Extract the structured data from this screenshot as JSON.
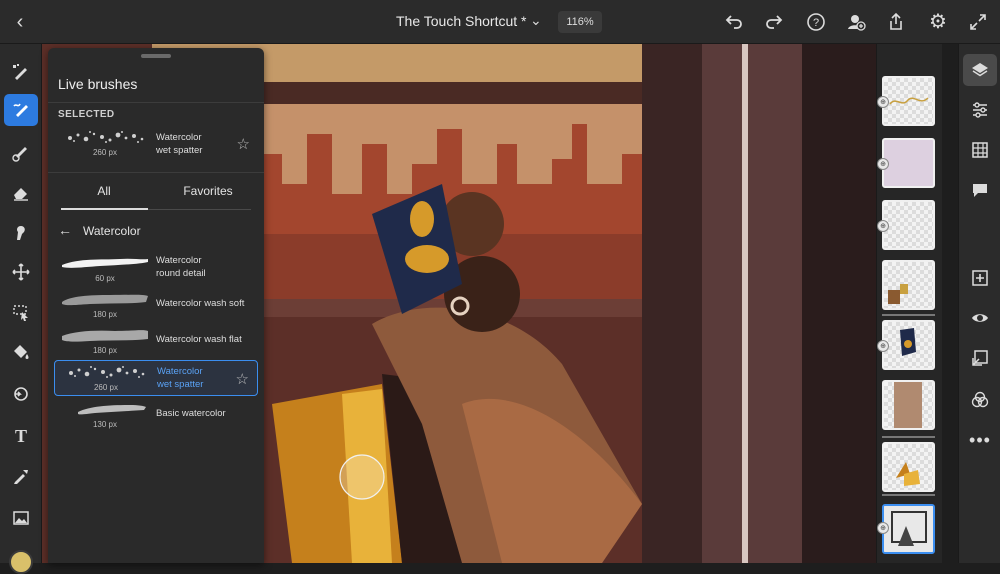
{
  "header": {
    "doc_title": "The Touch Shortcut *",
    "zoom": "116%"
  },
  "brushes_panel": {
    "title": "Live brushes",
    "selected_label": "SELECTED",
    "selected_brush": {
      "name_line1": "Watercolor",
      "name_line2": "wet spatter",
      "size": "260 px"
    },
    "tabs": [
      "All",
      "Favorites"
    ],
    "active_tab": "All",
    "category": "Watercolor",
    "brushes": [
      {
        "name_line1": "Watercolor",
        "name_line2": "round detail",
        "size": "60 px"
      },
      {
        "name_line1": "Watercolor wash soft",
        "name_line2": "",
        "size": "180 px"
      },
      {
        "name_line1": "Watercolor wash flat",
        "name_line2": "",
        "size": "180 px"
      },
      {
        "name_line1": "Watercolor",
        "name_line2": "wet spatter",
        "size": "260 px"
      },
      {
        "name_line1": "Basic watercolor",
        "name_line2": "",
        "size": "130 px"
      }
    ]
  },
  "icons": {
    "top_left": [
      "back-icon"
    ],
    "top_right": [
      "undo-icon",
      "redo-icon",
      "help-icon",
      "invite-icon",
      "share-icon",
      "settings-icon",
      "fullscreen-icon"
    ],
    "left_tools": [
      "pixel-brush-icon",
      "live-brush-icon",
      "vector-brush-icon",
      "eraser-icon",
      "smudge-icon",
      "transform-icon",
      "selection-icon",
      "fill-icon",
      "liquify-icon",
      "type-icon",
      "eyedropper-icon",
      "image-icon"
    ],
    "right_tools": [
      "layers-icon",
      "layer-properties-icon",
      "grid-icon",
      "comments-icon",
      "add-layer-icon",
      "visibility-icon",
      "import-icon",
      "blend-icon",
      "more-icon"
    ]
  },
  "colors": {
    "accent": "#2d7be0",
    "selected_text": "#5aa2f5",
    "current_color": "#d9c06a"
  }
}
